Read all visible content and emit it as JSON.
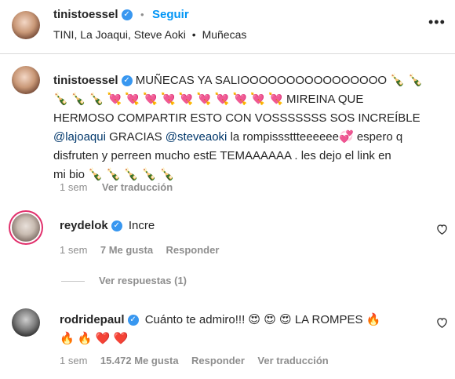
{
  "post_header": {
    "username": "tinistoessel",
    "follow_label": "Seguir",
    "subtitle_parts": [
      "TINI, La Joaqui, Steve Aoki",
      "Muñecas"
    ]
  },
  "caption": {
    "username": "tinistoessel",
    "line1": "MUÑECAS YA SALIOOOOOOOOOOOOOOOO 🍾 🍾",
    "line2": "🍾 🍾 🍾 💘 💘 💘 💘 💘 💘 💘 💘 💘 💘  MIREINA QUE",
    "line3": "HERMOSO COMPARTIR ESTO CON VOSSSSSSS SOS INCREÍBLE",
    "line4_mention1": "@lajoaqui",
    "line4_mid": " GRACIAS ",
    "line4_mention2": "@steveaoki",
    "line4_end": " la rompisssttteeeeee💞  espero q",
    "line5": "disfruten y perreen mucho estE TEMAAAAAA . les dejo el link en",
    "line6": "mi bio  🍾 🍾 🍾 🍾 🍾",
    "time": "1 sem",
    "translate": "Ver traducción"
  },
  "comments": [
    {
      "username": "reydelok",
      "text": "Incre",
      "time": "1 sem",
      "likes": "7 Me gusta",
      "reply": "Responder",
      "view_replies": "Ver respuestas (1)"
    },
    {
      "username": "rodridepaul",
      "text_line1": "Cuánto te admiro!!!  😍 😍 😍  LA ROMPES  🔥",
      "text_line2": "🔥 🔥 ❤️ ❤️",
      "time": "1 sem",
      "likes": "15.472 Me gusta",
      "reply": "Responder",
      "translate": "Ver traducción"
    }
  ],
  "icons": {
    "verified": "verified-badge-icon",
    "more": "more-options-icon",
    "heart": "heart-outline-icon"
  },
  "colors": {
    "link": "#0095f6",
    "verified": "#3897f0",
    "mention": "#00376b",
    "muted": "#8e8e8e"
  }
}
